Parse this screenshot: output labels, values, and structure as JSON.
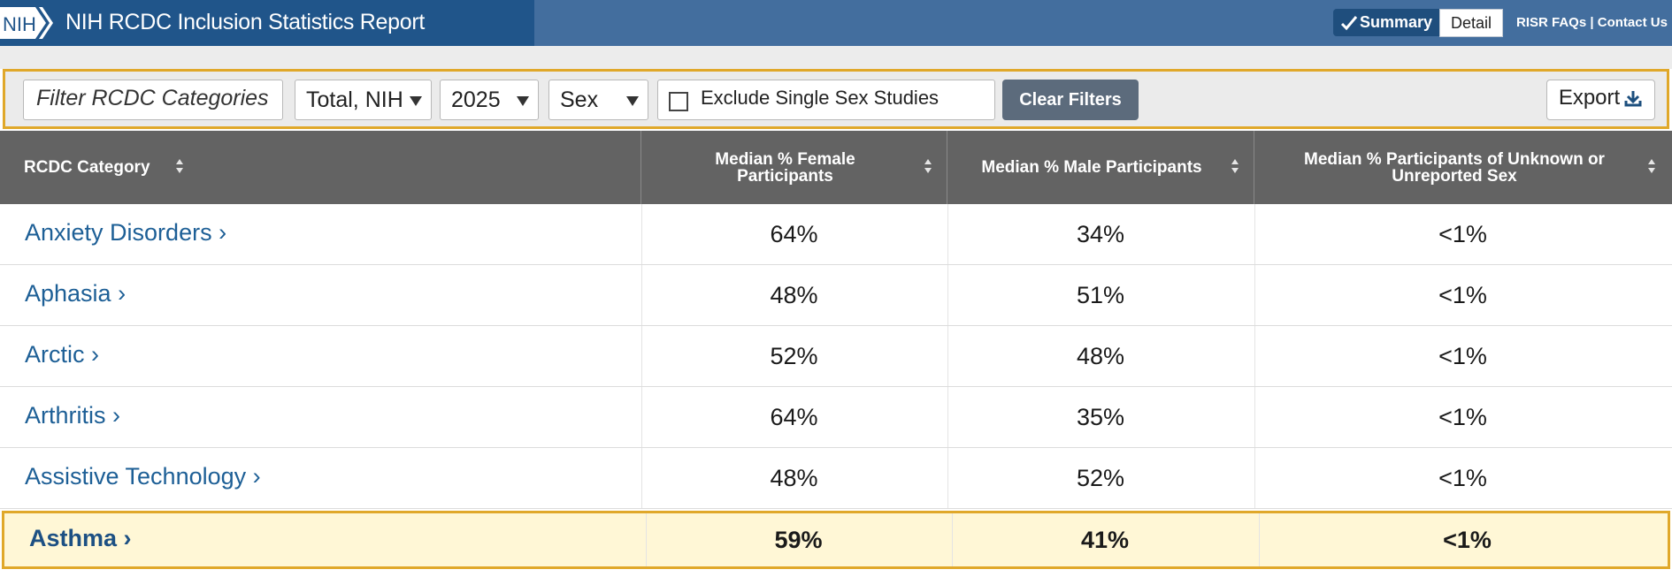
{
  "header": {
    "title": "NIH RCDC Inclusion Statistics Report",
    "logo_text": "NIH",
    "summary_label": "Summary",
    "detail_label": "Detail",
    "link_faqs": "RISR FAQs",
    "link_separator": " | ",
    "link_contact": "Contact Us"
  },
  "filters": {
    "search_placeholder": "Filter RCDC Categories",
    "funding_selected": "Total, NIH",
    "year_selected": "2025",
    "demographic_selected": "Sex",
    "exclude_label": "Exclude Single Sex Studies",
    "exclude_checked": false,
    "clear_label": "Clear Filters",
    "export_label": "Export"
  },
  "table": {
    "columns": [
      "RCDC Category",
      "Median % Female Participants",
      "Median % Male Participants",
      "Median % Participants of Unknown or Unreported Sex"
    ],
    "rows": [
      {
        "category": "Anxiety Disorders ›",
        "female": "64%",
        "male": "34%",
        "unknown": "<1%"
      },
      {
        "category": "Aphasia ›",
        "female": "48%",
        "male": "51%",
        "unknown": "<1%"
      },
      {
        "category": "Arctic ›",
        "female": "52%",
        "male": "48%",
        "unknown": "<1%"
      },
      {
        "category": "Arthritis ›",
        "female": "64%",
        "male": "35%",
        "unknown": "<1%"
      },
      {
        "category": "Assistive Technology ›",
        "female": "48%",
        "male": "52%",
        "unknown": "<1%"
      },
      {
        "category": "Asthma ›",
        "female": "59%",
        "male": "41%",
        "unknown": "<1%",
        "selected": true
      }
    ]
  },
  "colors": {
    "header_dark": "#20558a",
    "header_light": "#436e9e",
    "highlight_border": "#e0a82a",
    "highlight_fill": "#fff7d6",
    "link": "#1d5f96",
    "table_header": "#636363"
  }
}
